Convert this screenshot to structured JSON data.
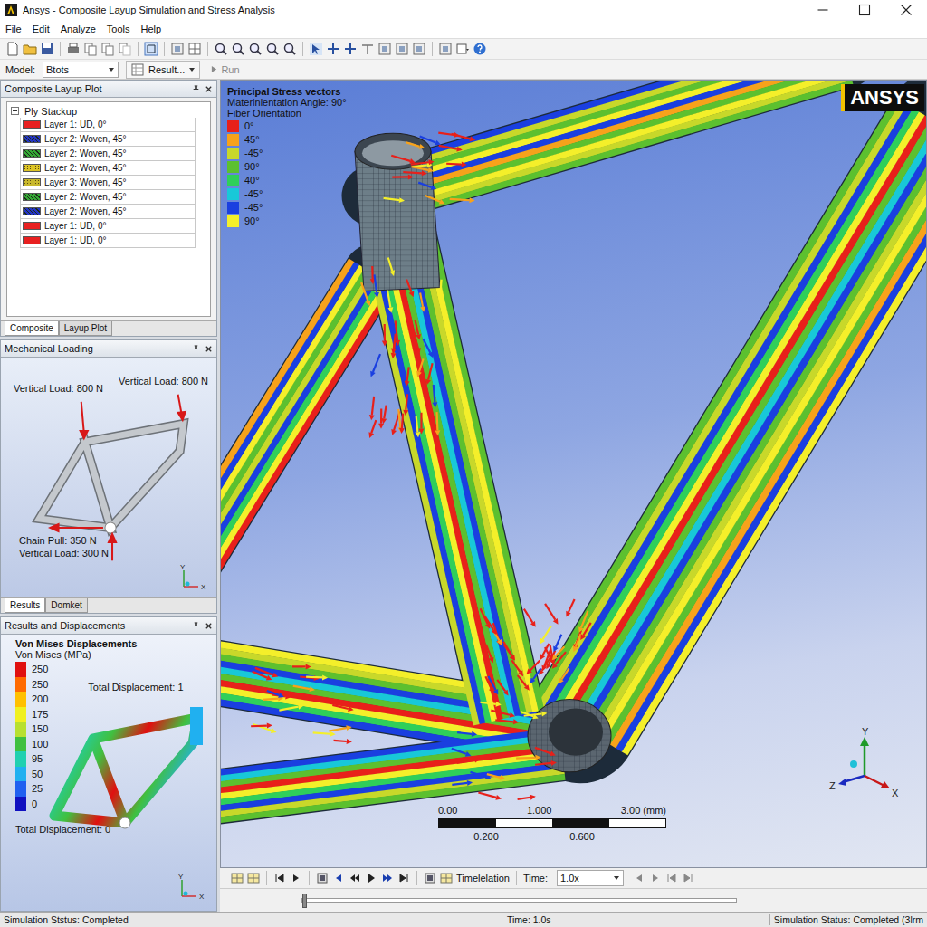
{
  "window": {
    "title": "Ansys - Composite Layup Simulation and Stress Analysis"
  },
  "menu": [
    "File",
    "Edit",
    "Analyze",
    "Tools",
    "Help"
  ],
  "model_bar": {
    "model_label": "Model:",
    "model_value": "Btots",
    "result_value": "Result...",
    "run": {
      "label": "Run",
      "disabled": true
    }
  },
  "layup_panel": {
    "title": "Composite Layup Plot",
    "tree_root": {
      "label": "Ply Stackup",
      "expanded": true
    },
    "layers": [
      {
        "label": "Layer 1: UD, 0°",
        "color": "#e82020",
        "kind": "solid"
      },
      {
        "label": "Layer 2: Woven, 45°",
        "color": "#2434c4",
        "kind": "hatch"
      },
      {
        "label": "Layer 2: Woven, 45°",
        "color": "#34a834",
        "kind": "hatch"
      },
      {
        "label": "Layer 2: Woven, 45°",
        "color": "#dcc424",
        "kind": "dots"
      },
      {
        "label": "Layer 3: Woven, 45°",
        "color": "#c8b82c",
        "kind": "dots"
      },
      {
        "label": "Layer 2: Woven, 45°",
        "color": "#34a834",
        "kind": "hatch"
      },
      {
        "label": "Layer 2: Woven, 45°",
        "color": "#2434c4",
        "kind": "hatch"
      },
      {
        "label": "Layer 1: UD, 0°",
        "color": "#e82020",
        "kind": "solid"
      },
      {
        "label": "Layer 1: UD, 0°",
        "color": "#e82020",
        "kind": "solid"
      }
    ],
    "tabs": [
      {
        "label": "Composite",
        "selected": true
      },
      {
        "label": "Layup Plot",
        "selected": false
      }
    ]
  },
  "loading_panel": {
    "title": "Mechanical Loading",
    "loads": [
      {
        "label": "Vertical Load: 800 N"
      },
      {
        "label": "Vertical Load: 800 N"
      },
      {
        "label": "Chain Pull: 350 N"
      },
      {
        "label": "Vertical Load: 300 N"
      }
    ],
    "axes": {
      "y": "Y",
      "x": "X"
    },
    "tabs": [
      {
        "label": "Results",
        "selected": true
      },
      {
        "label": "Domket",
        "selected": false
      }
    ]
  },
  "results_panel": {
    "title": "Results and Displacements",
    "heading": "Von Mises Displacements",
    "unit": "Von Mises (MPa)",
    "legend": [
      {
        "label": "250",
        "color": "#e01010"
      },
      {
        "label": "250",
        "color": "#ff6a00"
      },
      {
        "label": "200",
        "color": "#ffc000"
      },
      {
        "label": "175",
        "color": "#f0f020"
      },
      {
        "label": "150",
        "color": "#b8e030"
      },
      {
        "label": "100",
        "color": "#40c040"
      },
      {
        "label": "95",
        "color": "#20d0b0"
      },
      {
        "label": "50",
        "color": "#20b0f0"
      },
      {
        "label": "25",
        "color": "#2060f0"
      },
      {
        "label": "0",
        "color": "#1010c0"
      }
    ],
    "max_label": "Total Displacement: 1",
    "min_label": "Total Displacement: 0",
    "axes": {
      "y": "Y",
      "x": "X"
    }
  },
  "viewport": {
    "title": "Principal Stress vectors",
    "subtitle": "Materinientation Angle: 90°",
    "legend_title": "Fiber Orientation",
    "legend": [
      {
        "label": "0°",
        "color": "#e8201a"
      },
      {
        "label": "45°",
        "color": "#f7a21b"
      },
      {
        "label": "-45°",
        "color": "#c8d82a"
      },
      {
        "label": "90°",
        "color": "#5cc02f"
      },
      {
        "label": "40°",
        "color": "#2fcf5a"
      },
      {
        "label": "-45°",
        "color": "#18c8d8"
      },
      {
        "label": "-45°",
        "color": "#1a3fe0"
      },
      {
        "label": "90°",
        "color": "#f4ef2a"
      }
    ],
    "logo": "ANSYS",
    "scale": {
      "top": [
        "0.00",
        "1.000",
        "3.00 (mm)"
      ],
      "bottom": [
        "0.200",
        "0.600"
      ]
    },
    "axes": {
      "y": "Y",
      "z": "Z",
      "x": "X"
    }
  },
  "timeline": {
    "label": "Timelelation",
    "time_label": "Time:",
    "speed": "1.0x",
    "level": 0
  },
  "status_bar": [
    "Simulation Ststus: Completed",
    "Time: 1.0s",
    "Simulation Status: Completed (3lrm"
  ]
}
